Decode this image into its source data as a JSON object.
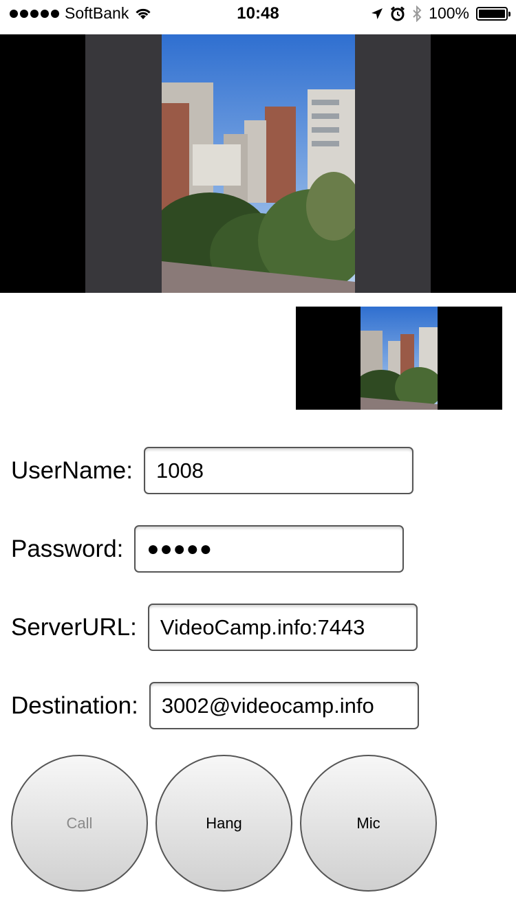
{
  "status_bar": {
    "carrier": "SoftBank",
    "time": "10:48",
    "battery": "100%",
    "icons": [
      "signal-dots-icon",
      "wifi-icon",
      "location-arrow-icon",
      "alarm-icon",
      "bluetooth-icon",
      "battery-icon"
    ]
  },
  "video": {
    "remote_icon": "remote-video-feed",
    "local_icon": "local-preview-feed",
    "scene_colors": {
      "sky": "#3f7fd8",
      "sky_light": "#b9d3f0",
      "building": "#c9c4bd",
      "brick": "#9a5a47",
      "tree": "#2f4a22",
      "tree_light": "#6a7d4a"
    }
  },
  "form": {
    "username_label": "UserName:",
    "username_value": "1008",
    "password_label": "Password:",
    "password_value": "●●●●●",
    "server_label": "ServerURL:",
    "server_value": "VideoCamp.info:7443",
    "destination_label": "Destination:",
    "destination_value": "3002@videocamp.info"
  },
  "buttons": {
    "call": "Call",
    "hang": "Hang",
    "mic": "Mic"
  }
}
